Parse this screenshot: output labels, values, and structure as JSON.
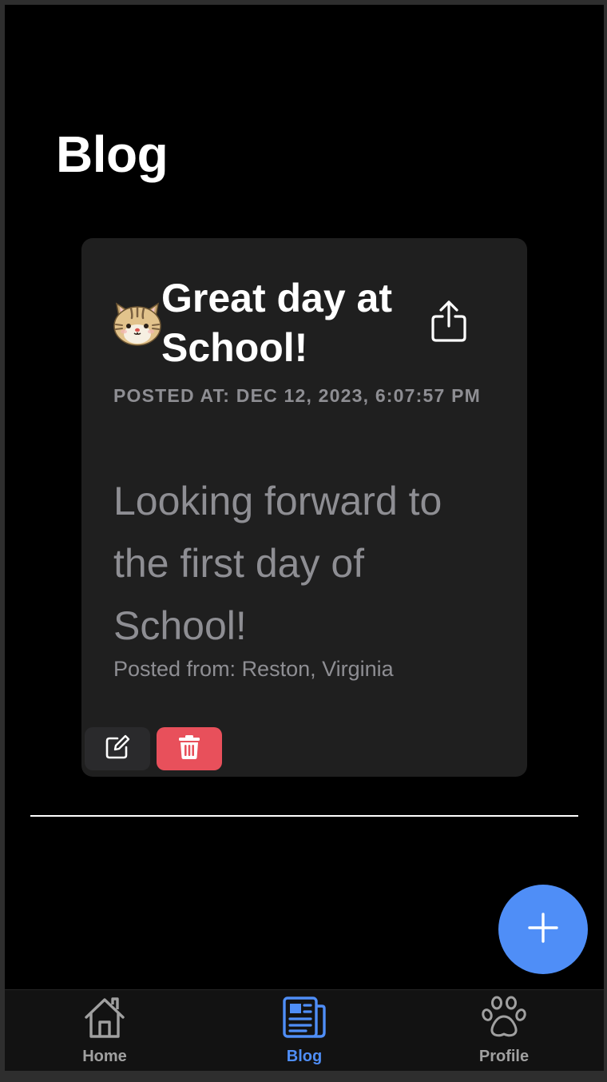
{
  "header": {
    "title": "Blog"
  },
  "post": {
    "avatar_icon": "cat-face-icon",
    "title": "Great day at School!",
    "posted_at": "Posted at: Dec 12, 2023, 6:07:57 PM",
    "body": "Looking forward to the first day of School!",
    "location": "Posted from: Reston, Virginia",
    "actions": {
      "share_icon": "share-icon",
      "edit_icon": "edit-icon",
      "delete_icon": "trash-icon"
    }
  },
  "fab": {
    "icon": "plus-icon"
  },
  "tabbar": {
    "tabs": [
      {
        "label": "Home",
        "icon": "house-icon",
        "active": false
      },
      {
        "label": "Blog",
        "icon": "newspaper-icon",
        "active": true
      },
      {
        "label": "Profile",
        "icon": "paw-icon",
        "active": false
      }
    ]
  },
  "colors": {
    "background": "#000000",
    "card": "#1f1f1f",
    "accent": "#4f8ef7",
    "danger": "#e8505b",
    "muted_text": "#8e8e93",
    "tab_inactive": "#a0a0a0"
  }
}
